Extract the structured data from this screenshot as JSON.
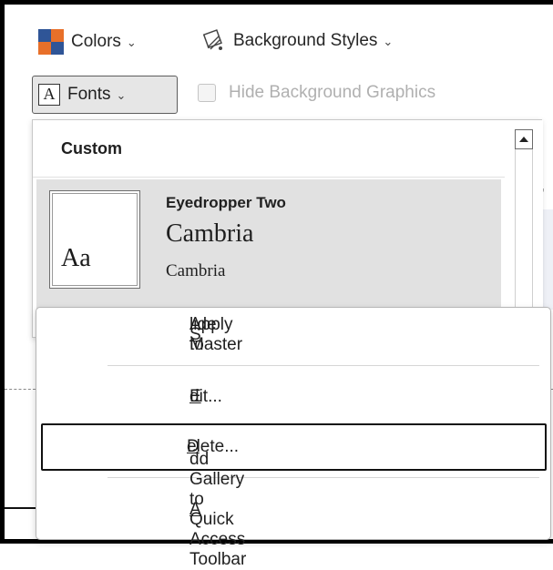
{
  "ribbon": {
    "colors_label": "Colors",
    "bg_styles_label": "Background Styles",
    "fonts_label": "Fonts",
    "fonts_icon_glyph": "A",
    "hide_bg_label": "Hide Background Graphics",
    "chevron_glyph": "⌄"
  },
  "gallery": {
    "section_header": "Custom",
    "items": [
      {
        "name": "Eyedropper Two",
        "heading_font": "Cambria",
        "body_font": "Cambria",
        "preview": "Aa"
      }
    ]
  },
  "context_menu": {
    "items": [
      {
        "pre": "Apply to ",
        "key": "S",
        "post": "lide Master"
      },
      {
        "pre": "",
        "key": "E",
        "post": "dit..."
      },
      {
        "pre": "",
        "key": "D",
        "post": "elete..."
      },
      {
        "pre": "",
        "key": "A",
        "post": "dd Gallery to Quick Access Toolbar"
      }
    ],
    "focused_item": "Delete..."
  },
  "colors": {
    "accent_orange": "#e8702a",
    "accent_blue": "#2f5597",
    "selection_gray": "#e1e1e1",
    "focus_border": "#111111"
  }
}
